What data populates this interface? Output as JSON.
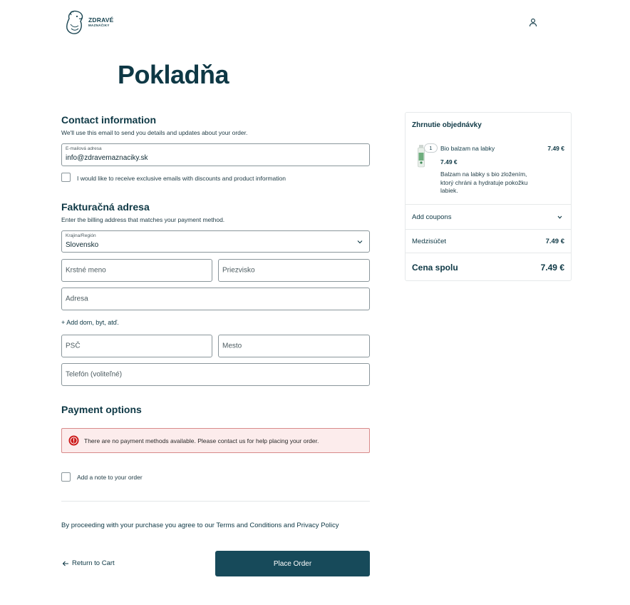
{
  "header": {
    "logo_line1": "ZDRAVÉ",
    "logo_line2": "MAZNÁČIKY",
    "account_icon": "user-icon"
  },
  "page": {
    "title": "Pokladňa"
  },
  "contact": {
    "title": "Contact information",
    "description": "We'll use this email to send you details and updates about your order.",
    "email_label": "E-mailová adresa",
    "email_value": "info@zdravemaznaciky.sk",
    "newsletter_label": "I would like to receive exclusive emails with discounts and product information"
  },
  "billing": {
    "title": "Fakturačná adresa",
    "description": "Enter the billing address that matches your payment method.",
    "country_label": "Krajina/Región",
    "country_value": "Slovensko",
    "first_name_placeholder": "Krstné meno",
    "last_name_placeholder": "Priezvisko",
    "address_placeholder": "Adresa",
    "add_address_link": "+ Add dom, byt, atď.",
    "postcode_placeholder": "PSČ",
    "city_placeholder": "Mesto",
    "phone_placeholder": "Telefón (voliteľné)"
  },
  "payment": {
    "title": "Payment options",
    "notice": "There are no payment methods available. Please contact us for help placing your order.",
    "notice_color": "#fcecec",
    "notice_icon": "alert-circle-icon"
  },
  "note": {
    "label": "Add a note to your order"
  },
  "terms": {
    "text": "By proceeding with your purchase you agree to our Terms and Conditions and Privacy Policy"
  },
  "actions": {
    "back_label": "Return to Cart",
    "place_order_label": "Place Order",
    "accent_color": "#174a5a"
  },
  "summary": {
    "title": "Zhrnutie objednávky",
    "item": {
      "quantity": "1",
      "name": "Bio balzam na labky",
      "price": "7.49 €",
      "line_total": "7.49 €",
      "description": "Balzam na labky s bio zložením, ktorý chráni a hydratuje pokožku labiek."
    },
    "coupons_label": "Add coupons",
    "subtotal_label": "Medzisúčet",
    "subtotal_value": "7.49 €",
    "total_label": "Cena spolu",
    "total_value": "7.49 €"
  }
}
